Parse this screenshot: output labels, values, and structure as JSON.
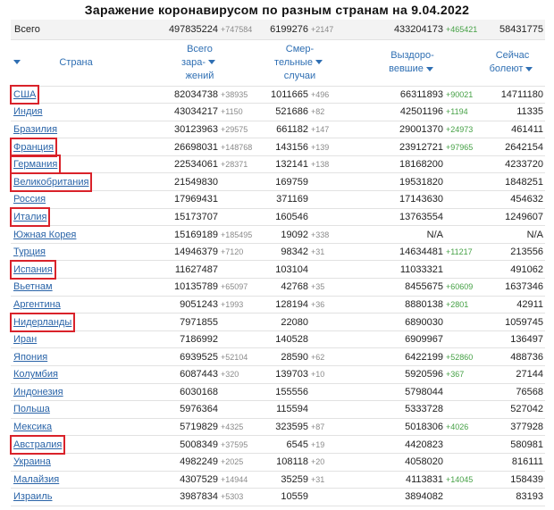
{
  "title": "Заражение коронавирусом по разным странам на 9.04.2022",
  "total": {
    "label": "Всего",
    "cases": "497835224",
    "cases_delta": "+747584",
    "deaths": "6199276",
    "deaths_delta": "+2147",
    "recovered": "433204173",
    "recovered_delta": "+465421",
    "active": "58431775"
  },
  "headers": {
    "country": "Страна",
    "cases": [
      "Всего",
      "зара-",
      "жений"
    ],
    "deaths": [
      "Смер-",
      "тельные",
      "случаи"
    ],
    "recovered": [
      "Выздоро-",
      "вевшие"
    ],
    "active": [
      "Сейчас",
      "болеют"
    ]
  },
  "icons": {
    "sort": "sort-arrow-down-icon"
  },
  "colors": {
    "link": "#2a64a8",
    "header": "#2f6fb3",
    "highlight_box": "#d9222a",
    "recovered_delta": "#46a146",
    "delta": "#8a8a8a"
  },
  "rows": [
    {
      "country": "США",
      "boxed": true,
      "cases": "82034738",
      "cases_delta": "+38935",
      "deaths": "1011665",
      "deaths_delta": "+496",
      "recovered": "66311893",
      "recovered_delta": "+90021",
      "active": "14711180"
    },
    {
      "country": "Индия",
      "boxed": false,
      "cases": "43034217",
      "cases_delta": "+1150",
      "deaths": "521686",
      "deaths_delta": "+82",
      "recovered": "42501196",
      "recovered_delta": "+1194",
      "active": "11335"
    },
    {
      "country": "Бразилия",
      "boxed": false,
      "cases": "30123963",
      "cases_delta": "+29575",
      "deaths": "661182",
      "deaths_delta": "+147",
      "recovered": "29001370",
      "recovered_delta": "+24973",
      "active": "461411"
    },
    {
      "country": "Франция",
      "boxed": true,
      "cases": "26698031",
      "cases_delta": "+148768",
      "deaths": "143156",
      "deaths_delta": "+139",
      "recovered": "23912721",
      "recovered_delta": "+97965",
      "active": "2642154"
    },
    {
      "country": "Германия",
      "boxed": true,
      "cases": "22534061",
      "cases_delta": "+28371",
      "deaths": "132141",
      "deaths_delta": "+138",
      "recovered": "18168200",
      "recovered_delta": "",
      "active": "4233720"
    },
    {
      "country": "Великобритания",
      "boxed": true,
      "cases": "21549830",
      "cases_delta": "",
      "deaths": "169759",
      "deaths_delta": "",
      "recovered": "19531820",
      "recovered_delta": "",
      "active": "1848251"
    },
    {
      "country": "Россия",
      "boxed": false,
      "cases": "17969431",
      "cases_delta": "",
      "deaths": "371169",
      "deaths_delta": "",
      "recovered": "17143630",
      "recovered_delta": "",
      "active": "454632"
    },
    {
      "country": "Италия",
      "boxed": true,
      "cases": "15173707",
      "cases_delta": "",
      "deaths": "160546",
      "deaths_delta": "",
      "recovered": "13763554",
      "recovered_delta": "",
      "active": "1249607"
    },
    {
      "country": "Южная Корея",
      "boxed": false,
      "cases": "15169189",
      "cases_delta": "+185495",
      "deaths": "19092",
      "deaths_delta": "+338",
      "recovered": "N/A",
      "recovered_delta": "",
      "active": "N/A"
    },
    {
      "country": "Турция",
      "boxed": false,
      "cases": "14946379",
      "cases_delta": "+7120",
      "deaths": "98342",
      "deaths_delta": "+31",
      "recovered": "14634481",
      "recovered_delta": "+11217",
      "active": "213556"
    },
    {
      "country": "Испания",
      "boxed": true,
      "cases": "11627487",
      "cases_delta": "",
      "deaths": "103104",
      "deaths_delta": "",
      "recovered": "11033321",
      "recovered_delta": "",
      "active": "491062"
    },
    {
      "country": "Вьетнам",
      "boxed": false,
      "cases": "10135789",
      "cases_delta": "+65097",
      "deaths": "42768",
      "deaths_delta": "+35",
      "recovered": "8455675",
      "recovered_delta": "+60609",
      "active": "1637346"
    },
    {
      "country": "Аргентина",
      "boxed": false,
      "cases": "9051243",
      "cases_delta": "+1993",
      "deaths": "128194",
      "deaths_delta": "+36",
      "recovered": "8880138",
      "recovered_delta": "+2801",
      "active": "42911"
    },
    {
      "country": "Нидерланды",
      "boxed": true,
      "cases": "7971855",
      "cases_delta": "",
      "deaths": "22080",
      "deaths_delta": "",
      "recovered": "6890030",
      "recovered_delta": "",
      "active": "1059745"
    },
    {
      "country": "Иран",
      "boxed": false,
      "cases": "7186992",
      "cases_delta": "",
      "deaths": "140528",
      "deaths_delta": "",
      "recovered": "6909967",
      "recovered_delta": "",
      "active": "136497"
    },
    {
      "country": "Япония",
      "boxed": false,
      "cases": "6939525",
      "cases_delta": "+52104",
      "deaths": "28590",
      "deaths_delta": "+62",
      "recovered": "6422199",
      "recovered_delta": "+52860",
      "active": "488736"
    },
    {
      "country": "Колумбия",
      "boxed": false,
      "cases": "6087443",
      "cases_delta": "+320",
      "deaths": "139703",
      "deaths_delta": "+10",
      "recovered": "5920596",
      "recovered_delta": "+367",
      "active": "27144"
    },
    {
      "country": "Индонезия",
      "boxed": false,
      "cases": "6030168",
      "cases_delta": "",
      "deaths": "155556",
      "deaths_delta": "",
      "recovered": "5798044",
      "recovered_delta": "",
      "active": "76568"
    },
    {
      "country": "Польша",
      "boxed": false,
      "cases": "5976364",
      "cases_delta": "",
      "deaths": "115594",
      "deaths_delta": "",
      "recovered": "5333728",
      "recovered_delta": "",
      "active": "527042"
    },
    {
      "country": "Мексика",
      "boxed": false,
      "cases": "5719829",
      "cases_delta": "+4325",
      "deaths": "323595",
      "deaths_delta": "+87",
      "recovered": "5018306",
      "recovered_delta": "+4026",
      "active": "377928"
    },
    {
      "country": "Австралия",
      "boxed": true,
      "cases": "5008349",
      "cases_delta": "+37595",
      "deaths": "6545",
      "deaths_delta": "+19",
      "recovered": "4420823",
      "recovered_delta": "",
      "active": "580981"
    },
    {
      "country": "Украина",
      "boxed": false,
      "cases": "4982249",
      "cases_delta": "+2025",
      "deaths": "108118",
      "deaths_delta": "+20",
      "recovered": "4058020",
      "recovered_delta": "",
      "active": "816111"
    },
    {
      "country": "Малайзия",
      "boxed": false,
      "cases": "4307529",
      "cases_delta": "+14944",
      "deaths": "35259",
      "deaths_delta": "+31",
      "recovered": "4113831",
      "recovered_delta": "+14045",
      "active": "158439"
    },
    {
      "country": "Израиль",
      "boxed": false,
      "cases": "3987834",
      "cases_delta": "+5303",
      "deaths": "10559",
      "deaths_delta": "",
      "recovered": "3894082",
      "recovered_delta": "",
      "active": "83193"
    }
  ]
}
